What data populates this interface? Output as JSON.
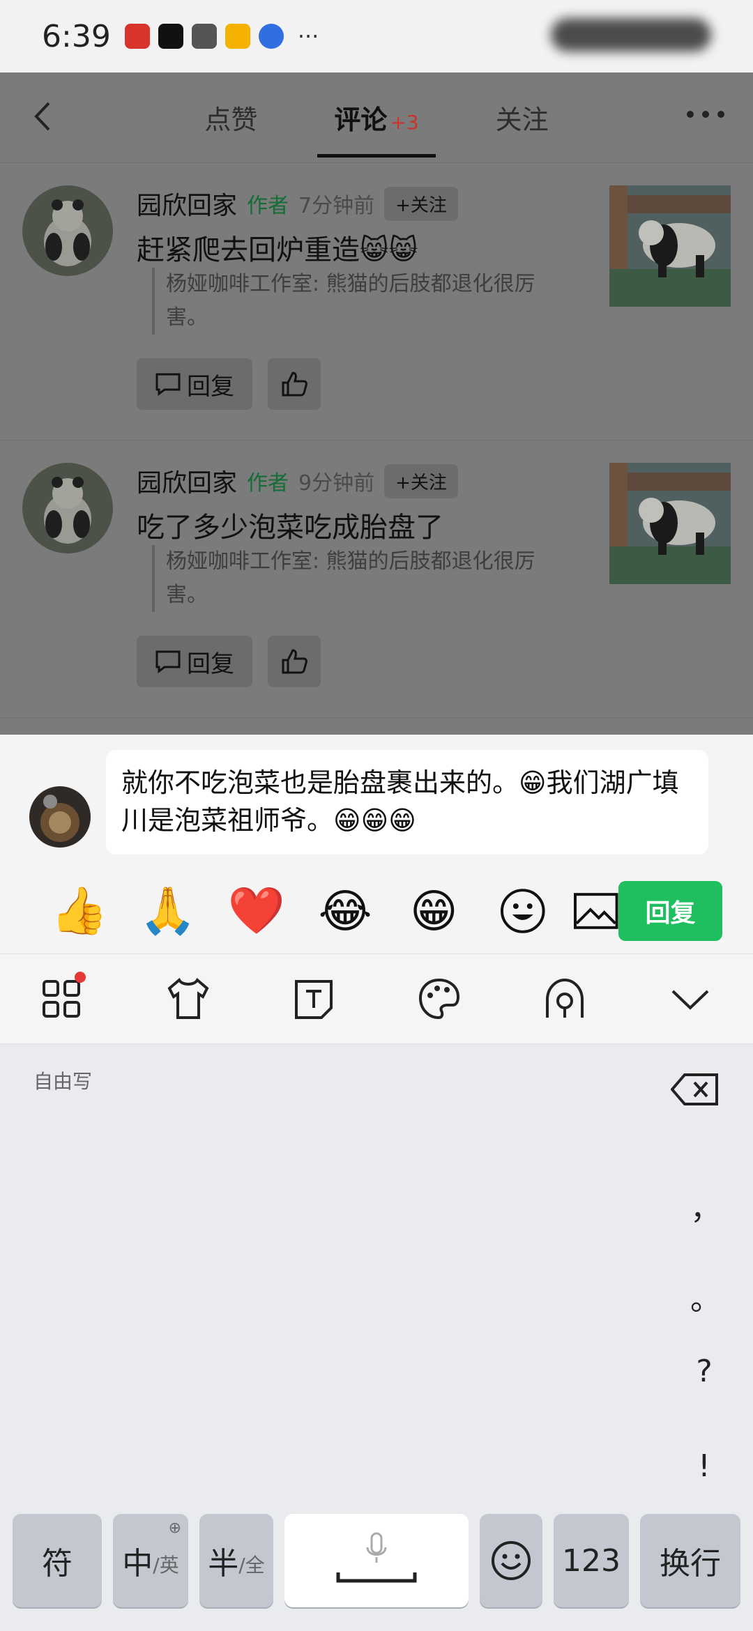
{
  "status_bar": {
    "time": "6:39"
  },
  "nav": {
    "tabs": [
      {
        "label": "点赞"
      },
      {
        "label": "评论",
        "badge": "+3"
      },
      {
        "label": "关注"
      }
    ]
  },
  "comments": [
    {
      "name": "园欣回家",
      "tag": "作者",
      "time": "7分钟前",
      "follow": "+关注",
      "text": "赶紧爬去回炉重造😸😸",
      "quote": "杨娅咖啡工作室: 熊猫的后肢都退化很厉害。",
      "reply_label": "回复"
    },
    {
      "name": "园欣回家",
      "tag": "作者",
      "time": "9分钟前",
      "follow": "+关注",
      "text": "吃了多少泡菜吃成胎盘了",
      "quote": "杨娅咖啡工作室: 熊猫的后肢都退化很厉害。",
      "reply_label": "回复"
    }
  ],
  "compose": {
    "input_value": "就你不吃泡菜也是胎盘裹出来的。😁我们湖广填川是泡菜祖师爷。😁😁😁",
    "emojis": [
      "👍",
      "🙏",
      "❤️",
      "😂",
      "😁"
    ],
    "send_label": "回复"
  },
  "keyboard": {
    "free_write": "自由写",
    "punctuation": [
      "，",
      "。",
      "?",
      "!"
    ],
    "keys": {
      "symbol": "符",
      "zh_main": "中",
      "zh_sub": "/英",
      "half_main": "半",
      "half_sub": "/全",
      "numbers": "123",
      "enter": "换行"
    }
  },
  "icons": [
    "back-arrow-icon",
    "more-icon",
    "comment-icon",
    "thumbs-up-icon",
    "smile-icon",
    "image-icon",
    "apps-grid-icon",
    "shirt-icon",
    "text-box-icon",
    "palette-icon",
    "handwriting-icon",
    "chevron-down-icon",
    "backspace-icon",
    "microphone-icon",
    "globe-icon"
  ],
  "colors": {
    "accent_green": "#1fbf5f",
    "badge_red": "#c9332c",
    "author_green": "#146c36"
  }
}
